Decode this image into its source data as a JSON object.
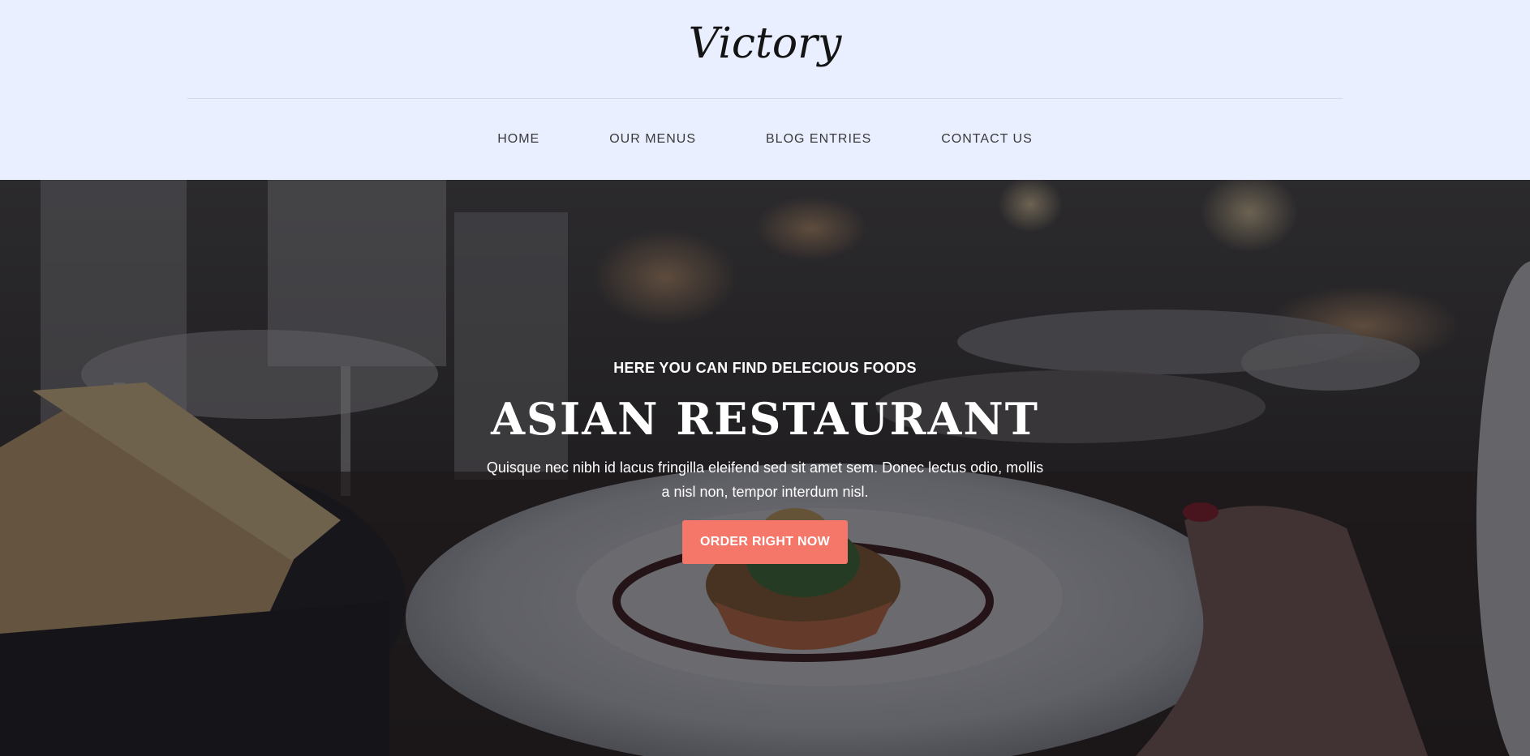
{
  "header": {
    "logo": "Victory",
    "nav": [
      {
        "label": "HOME"
      },
      {
        "label": "OUR MENUS"
      },
      {
        "label": "BLOG ENTRIES"
      },
      {
        "label": "CONTACT US"
      }
    ]
  },
  "hero": {
    "eyebrow": "HERE YOU CAN FIND DELECIOUS FOODS",
    "title": "ASIAN RESTAURANT",
    "text": "Quisque nec nibh id lacus fringilla eleifend sed sit amet sem. Donec lectus odio, mollis a nisl non, tempor interdum nisl.",
    "button_label": "ORDER RIGHT NOW"
  },
  "colors": {
    "header_bg": "#e9efff",
    "accent": "#f4776a",
    "hero_overlay": "#12141e"
  }
}
